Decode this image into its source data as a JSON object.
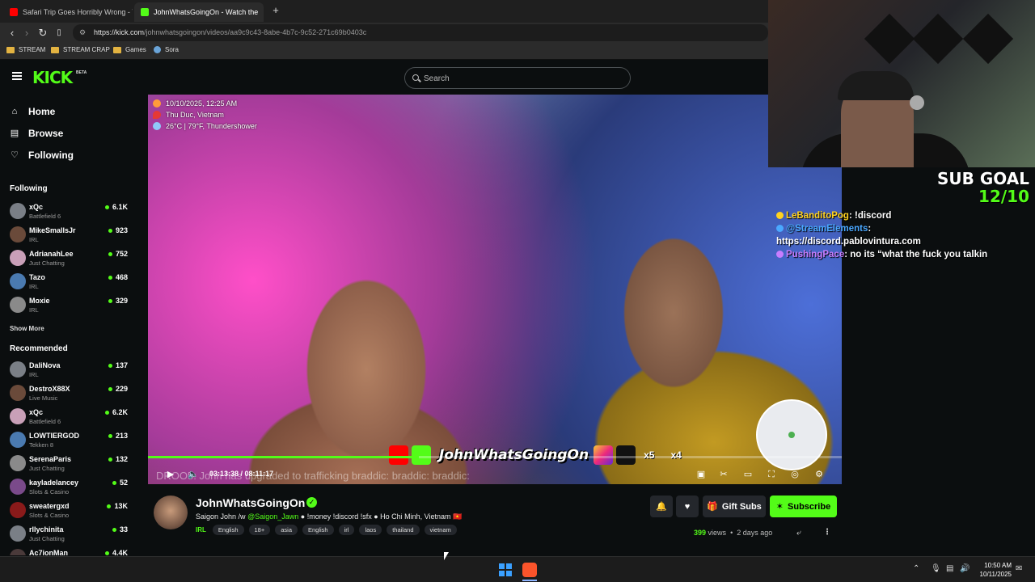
{
  "browser": {
    "tabs": [
      {
        "label": "Safari Trip Goes Horribly Wrong - Yo",
        "favicon": "youtube-icon"
      },
      {
        "label": "JohnWhatsGoingOn - Watch the",
        "favicon": "kick-icon",
        "active": true
      }
    ],
    "new_tab": "+",
    "url_domain": "https://kick.com",
    "url_path": "/johnwhatsgoingon/videos/aa9c9c43-8abe-4b7c-9c52-271c69b0403c",
    "bookmarks": [
      {
        "label": "STREAM",
        "icon": "folder-icon"
      },
      {
        "label": "STREAM CRAP",
        "icon": "folder-icon"
      },
      {
        "label": "Games",
        "icon": "folder-icon"
      },
      {
        "label": "Sora",
        "icon": "sora-icon"
      }
    ]
  },
  "header": {
    "logo": "KICK",
    "beta": "BETA",
    "search_placeholder": "Search"
  },
  "sidebar": {
    "nav": [
      {
        "label": "Home",
        "icon": "home-icon"
      },
      {
        "label": "Browse",
        "icon": "browse-icon"
      },
      {
        "label": "Following",
        "icon": "heart-icon"
      }
    ],
    "following_title": "Following",
    "following": [
      {
        "name": "xQc",
        "category": "Battlefield 6",
        "viewers": "6.1K"
      },
      {
        "name": "MikeSmallsJr",
        "category": "IRL",
        "viewers": "923"
      },
      {
        "name": "AdrianahLee",
        "category": "Just Chatting",
        "viewers": "752"
      },
      {
        "name": "Tazo",
        "category": "IRL",
        "viewers": "468"
      },
      {
        "name": "Moxie",
        "category": "IRL",
        "viewers": "329"
      }
    ],
    "show_more": "Show More",
    "recommended_title": "Recommended",
    "recommended": [
      {
        "name": "DaliNova",
        "category": "IRL",
        "viewers": "137"
      },
      {
        "name": "DestroX88X",
        "category": "Live Music",
        "viewers": "229"
      },
      {
        "name": "xQc",
        "category": "Battlefield 6",
        "viewers": "6.2K"
      },
      {
        "name": "LOWTIERGOD",
        "category": "Tekken 8",
        "viewers": "213"
      },
      {
        "name": "SerenaParis",
        "category": "Just Chatting",
        "viewers": "132"
      },
      {
        "name": "kayladelancey",
        "category": "Slots & Casino",
        "viewers": "52"
      },
      {
        "name": "sweatergxd",
        "category": "Slots & Casino",
        "viewers": "13K"
      },
      {
        "name": "rllychinita",
        "category": "Just Chatting",
        "viewers": "33"
      },
      {
        "name": "Ac7ionMan",
        "category": "",
        "viewers": "4.4K"
      }
    ]
  },
  "video": {
    "overlay_datetime": "10/10/2025, 12:25 AM",
    "overlay_location": "Thu Duc, Vietnam",
    "overlay_weather": "26°C | 79°F, Thundershower",
    "brand_text": "JohnWhatsGoingOn",
    "brand_count_1": "x5",
    "brand_count_2": "x4",
    "chat_banner": "DROO5: John has upgraded to trafficking braddic: braddic: braddic:",
    "current_time": "03:13:38",
    "duration": "08:11:17",
    "progress_fraction": 0.39
  },
  "stream_overlay": {
    "subgoal_title": "SUB GOAL",
    "subgoal_value": "12/10",
    "chat": [
      {
        "user": "LeBanditoPog",
        "user_color": "#ffd21f",
        "message": "!discord"
      },
      {
        "user": "@StreamElements",
        "user_color": "#4aa8ff",
        "message": ""
      },
      {
        "user": "",
        "user_color": "#ffffff",
        "message": "https://discord.pablovintura.com"
      },
      {
        "user": "PushingPace",
        "user_color": "#c77dff",
        "message": "no its “what the fuck you talkin"
      }
    ]
  },
  "channel": {
    "name": "JohnWhatsGoingOn",
    "title_prefix": "Saigon John /w",
    "title_mention": "@Saigon_Jawn",
    "title_suffix": "● !money !discord !sfx ● Ho Chi Minh, Vietnam 🇻🇳",
    "category": "IRL",
    "tags": [
      "English",
      "18+",
      "asia",
      "English",
      "irl",
      "laos",
      "thailand",
      "vietnam"
    ],
    "gift_label": "Gift Subs",
    "subscribe_label": "Subscribe",
    "views": "399",
    "views_label": "views",
    "age": "2 days ago"
  },
  "taskbar": {
    "time": "10:50 AM",
    "date": "10/11/2025"
  },
  "colors": {
    "accent": "#53fc18",
    "background": "#0b0e0f",
    "button_bg": "#24272c"
  }
}
